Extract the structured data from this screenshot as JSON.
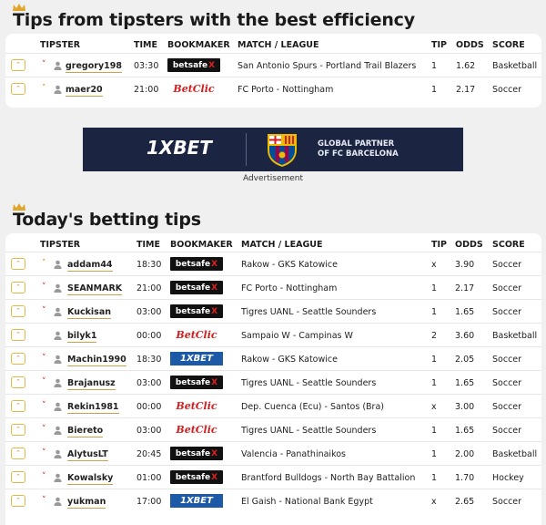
{
  "best_section": {
    "title": "Tips from tipsters with the best efficiency",
    "headers": {
      "tipster": "TIPSTER",
      "time": "TIME",
      "bookmaker": "BOOKMAKER",
      "match": "MATCH / LEAGUE",
      "tip": "TIP",
      "odds": "ODDS",
      "score": "SCORE"
    },
    "rows": [
      {
        "trend": "down",
        "tipster": "gregory198",
        "time": "03:30",
        "bookmaker": "betsafe",
        "match": "San Antonio Spurs - Portland Trail Blazers",
        "tip": "1",
        "odds": "1.62",
        "score": "Basketball"
      },
      {
        "trend": "up",
        "tipster": "maer20",
        "time": "21:00",
        "bookmaker": "betclic",
        "match": "FC Porto - Nottingham",
        "tip": "1",
        "odds": "2.17",
        "score": "Soccer"
      }
    ]
  },
  "ad": {
    "brand": "1XBET",
    "line1": "GLOBAL PARTNER",
    "line2": "OF FC BARCELONA",
    "caption": "Advertisement",
    "colors": {
      "bg": "#1b2440",
      "crest_red": "#a50044",
      "crest_blue": "#004d98",
      "crest_gold": "#edbb00"
    }
  },
  "today_section": {
    "title": "Today's betting tips",
    "headers": {
      "tipster": "TIPSTER",
      "time": "TIME",
      "bookmaker": "BOOKMAKER",
      "match": "MATCH / LEAGUE",
      "tip": "TIP",
      "odds": "ODDS",
      "score": "SCORE"
    },
    "rows": [
      {
        "trend": "up",
        "tipster": "addam44",
        "time": "18:30",
        "bookmaker": "betsafe",
        "match": "Rakow - GKS Katowice",
        "tip": "x",
        "odds": "3.90",
        "score": "Soccer"
      },
      {
        "trend": "down",
        "tipster": "SEANMARK",
        "time": "21:00",
        "bookmaker": "betsafe",
        "match": "FC Porto - Nottingham",
        "tip": "1",
        "odds": "2.17",
        "score": "Soccer"
      },
      {
        "trend": "down",
        "tipster": "Kuckisan",
        "time": "03:00",
        "bookmaker": "betsafe",
        "match": "Tigres UANL - Seattle Sounders",
        "tip": "1",
        "odds": "1.65",
        "score": "Soccer"
      },
      {
        "trend": "none",
        "tipster": "bilyk1",
        "time": "00:00",
        "bookmaker": "betclic",
        "match": "Sampaio W - Campinas W",
        "tip": "2",
        "odds": "3.60",
        "score": "Basketball"
      },
      {
        "trend": "down",
        "tipster": "Machin1990",
        "time": "18:30",
        "bookmaker": "1xbet",
        "match": "Rakow - GKS Katowice",
        "tip": "1",
        "odds": "2.05",
        "score": "Soccer"
      },
      {
        "trend": "down",
        "tipster": "Brajanusz",
        "time": "03:00",
        "bookmaker": "betsafe",
        "match": "Tigres UANL - Seattle Sounders",
        "tip": "1",
        "odds": "1.65",
        "score": "Soccer"
      },
      {
        "trend": "down",
        "tipster": "Rekin1981",
        "time": "00:00",
        "bookmaker": "betclic",
        "match": "Dep. Cuenca (Ecu) - Santos (Bra)",
        "tip": "x",
        "odds": "3.00",
        "score": "Soccer"
      },
      {
        "trend": "down",
        "tipster": "Biereto",
        "time": "03:00",
        "bookmaker": "betclic",
        "match": "Tigres UANL - Seattle Sounders",
        "tip": "1",
        "odds": "1.65",
        "score": "Soccer"
      },
      {
        "trend": "down",
        "tipster": "AlytusLT",
        "time": "20:45",
        "bookmaker": "betsafe",
        "match": "Valencia - Panathinaikos",
        "tip": "1",
        "odds": "2.00",
        "score": "Basketball"
      },
      {
        "trend": "down",
        "tipster": "Kowalsky",
        "time": "01:00",
        "bookmaker": "betsafe",
        "match": "Brantford Bulldogs - North Bay Battalion",
        "tip": "1",
        "odds": "1.70",
        "score": "Hockey"
      },
      {
        "trend": "down",
        "tipster": "yukman",
        "time": "17:00",
        "bookmaker": "1xbet",
        "match": "El Gaish - National Bank Egypt",
        "tip": "x",
        "odds": "2.65",
        "score": "Soccer"
      }
    ]
  },
  "bookmaker_logos": {
    "betsafe": {
      "text": "betsafe",
      "mark": "X"
    },
    "betclic": {
      "text": "BetClic"
    },
    "1xbet": {
      "text": "1XBET"
    }
  },
  "colors": {
    "accent": "#d9a32a",
    "down": "#d33333",
    "betsafe_bg": "#111111",
    "betclic": "#d41c1c",
    "onexbet": "#1c5aa8"
  }
}
